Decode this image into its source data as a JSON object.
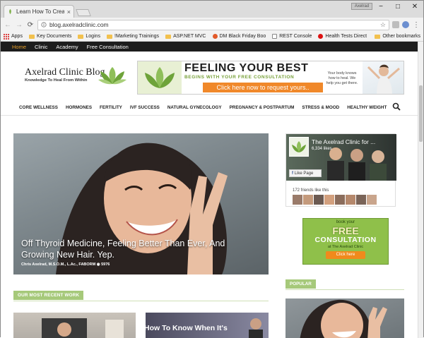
{
  "browser": {
    "tab_title": "Learn How To Create Tha",
    "tab_close": "×",
    "user_label": "Axelrad",
    "window_min": "−",
    "window_max": "□",
    "window_close": "✕",
    "url": "blog.axelradclinic.com",
    "bookmarks": [
      {
        "label": "Apps",
        "icon": "apps-grid-icon"
      },
      {
        "label": "Key Documents",
        "icon": "folder-icon"
      },
      {
        "label": "Logins",
        "icon": "folder-icon"
      },
      {
        "label": "!Marketing Trainings",
        "icon": "folder-icon"
      },
      {
        "label": "ASP.NET MVC",
        "icon": "folder-icon"
      },
      {
        "label": "DM Black Friday Boo",
        "icon": "site-icon"
      },
      {
        "label": "REST Console",
        "icon": "page-icon"
      },
      {
        "label": "Health Tests Direct",
        "icon": "drop-icon"
      }
    ],
    "other_bookmarks": "Other bookmarks"
  },
  "site": {
    "topnav": [
      "Home",
      "Clinic",
      "Academy",
      "Free Consultation"
    ],
    "logo_title": "Axelrad Clinic Blog",
    "logo_tagline": "Knowledge To Heal From Within",
    "banner": {
      "headline": "FEELING YOUR BEST",
      "subhead": "BEGINS WITH YOUR FREE CONSULTATION",
      "cta": "Click here now to request yours..",
      "side_text": "Your body knows how to heal. We help you get there."
    },
    "mainnav": [
      "CORE WELLNESS",
      "HORMONES",
      "FERTILITY",
      "IVF SUCCESS",
      "NATURAL GYNECOLOGY",
      "PREGNANCY & POSTPARTUM",
      "STRESS & MOOD",
      "HEALTHY WEIGHT"
    ],
    "hero": {
      "title": "Off Thyroid Medicine, Feeling Better Than Ever, And Growing New Hair. Yep.",
      "meta": "Chris Axelrad, M.S.O.M., L.Ac., FABORM",
      "views": "5976"
    },
    "facebook": {
      "page_name": "The Axelrad Clinic for ...",
      "likes": "6,334 likes",
      "like_button": "Like Page",
      "friends": "172 friends like this"
    },
    "ad": {
      "line1": "book your",
      "line2": "FREE",
      "line3": "CONSULTATION",
      "line4": "at The Axelrad Clinic",
      "button": "Click here"
    },
    "section_recent": "OUR MOST RECENT WORK",
    "section_popular": "POPULAR",
    "card2_title": "How To Know When It's"
  },
  "colors": {
    "accent_orange": "#e8a02a",
    "green": "#a6c97a",
    "cta_orange": "#f0882a"
  }
}
